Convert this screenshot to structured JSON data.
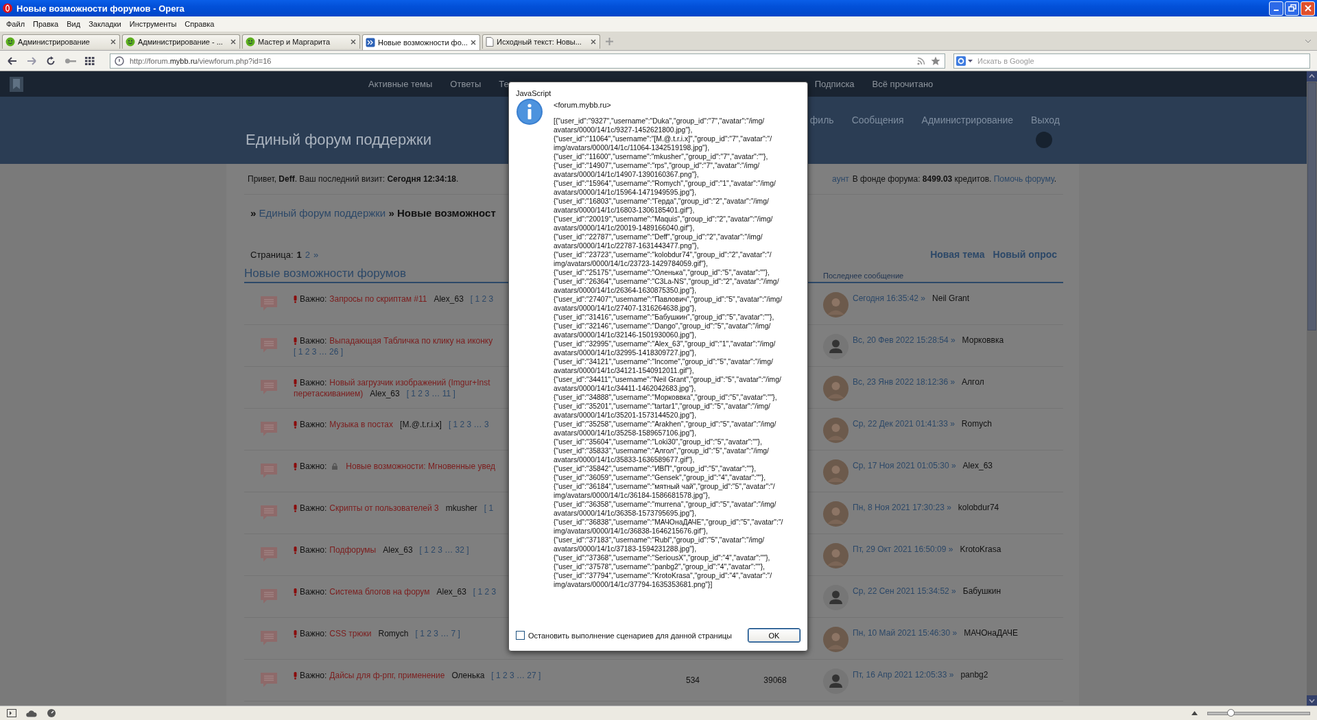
{
  "window": {
    "title": "Новые возможности форумов - Opera"
  },
  "menu": [
    "Файл",
    "Правка",
    "Вид",
    "Закладки",
    "Инструменты",
    "Справка"
  ],
  "tabs": [
    {
      "label": "Администрирование",
      "kind": "green",
      "selected": false
    },
    {
      "label": "Администрирование - ...",
      "kind": "green",
      "selected": false
    },
    {
      "label": "Мастер и Маргарита",
      "kind": "green",
      "selected": false
    },
    {
      "label": "Новые возможности фо...",
      "kind": "forum",
      "selected": true
    },
    {
      "label": "Исходный текст: Новы...",
      "kind": "page",
      "selected": false
    }
  ],
  "address": {
    "value": "http://forum.**mybb.ru**/viewforum.php?id=16"
  },
  "search": {
    "placeholder": "Искать в Google"
  },
  "forum": {
    "nav_left": [
      "Активные темы",
      "Ответы",
      "Те"
    ],
    "nav_right": [
      "Подписка",
      "Всё прочитано"
    ],
    "title": "Единый форум поддержки",
    "header_nav": [
      "филь",
      "Сообщения",
      "Администрирование",
      "Выход"
    ],
    "greeting": "Привет, **Deff**.  Ваш последний визит: **Сегодня 12:34:18**.",
    "account_link": "аунт",
    "fund_text": "В фонде форума: **8499.03** кредитов.",
    "fund_link": "Помочь форуму",
    "fund_end": ".",
    "breadcrumb": {
      "prefix": "»",
      "link": "Единый форум поддержки",
      "current": "» Новые возможност"
    },
    "pagination": {
      "label": "Страница:",
      "current": "1",
      "links": [
        "2",
        "»"
      ]
    },
    "actions": [
      "Новая тема",
      "Новый опрос"
    ],
    "section_title": "Новые возможности форумов",
    "last_post_header": "Последнее сообщение",
    "topics": [
      {
        "lines": [
          [
            {
              "kind": "important",
              "text": "Важно:"
            },
            {
              "kind": "title",
              "text": "Запросы по скриптам #11"
            },
            {
              "kind": "author",
              "text": "Alex_63"
            },
            {
              "kind": "pages",
              "text": "[ 1 2 3"
            }
          ]
        ],
        "last_post": {
          "date": "Сегодня 16:35:42 »",
          "user": "Neil Grant",
          "kind": "photo"
        }
      },
      {
        "lines": [
          [
            {
              "kind": "important",
              "text": "Важно:"
            },
            {
              "kind": "title",
              "text": "Выпадающая Табличка по клику на иконку"
            }
          ],
          [
            {
              "kind": "pages",
              "text": "[ 1 2 3 … 26 ]"
            }
          ]
        ],
        "last_post": {
          "date": "Вс, 20 Фев 2022 15:28:54 »",
          "user": "Морковвка",
          "kind": "default"
        }
      },
      {
        "lines": [
          [
            {
              "kind": "important",
              "text": "Важно:"
            },
            {
              "kind": "title",
              "text": "Новый загрузчик изображений (Imgur+Inst"
            }
          ],
          [
            {
              "kind": "title",
              "text": "перетаскиванием)"
            },
            {
              "kind": "author",
              "text": "Alex_63"
            },
            {
              "kind": "pages",
              "text": "[ 1 2 3 … 11 ]"
            }
          ]
        ],
        "last_post": {
          "date": "Вс, 23 Янв 2022 18:12:36 »",
          "user": "Алгол",
          "kind": "photo"
        }
      },
      {
        "lines": [
          [
            {
              "kind": "important",
              "text": "Важно:"
            },
            {
              "kind": "title",
              "text": "Музыка в постах"
            },
            {
              "kind": "author",
              "text": "[M.@.t.r.i.x]"
            },
            {
              "kind": "pages",
              "text": "[ 1 2 3 … 3"
            }
          ]
        ],
        "last_post": {
          "date": "Ср, 22 Дек 2021 01:41:33 »",
          "user": "Romych",
          "kind": "photo"
        }
      },
      {
        "lines": [
          [
            {
              "kind": "important",
              "text": "Важно:"
            },
            {
              "kind": "lock"
            },
            {
              "kind": "title",
              "text": "Новые возможности: Мгновенные увед"
            }
          ]
        ],
        "last_post": {
          "date": "Ср, 17 Ноя 2021 01:05:30 »",
          "user": "Alex_63",
          "kind": "photo"
        }
      },
      {
        "lines": [
          [
            {
              "kind": "important",
              "text": "Важно:"
            },
            {
              "kind": "title",
              "text": "Скрипты от пользователей 3"
            },
            {
              "kind": "author",
              "text": "mkusher"
            },
            {
              "kind": "pages",
              "text": "[ 1"
            }
          ]
        ],
        "last_post": {
          "date": "Пн, 8 Ноя 2021 17:30:23 »",
          "user": "kolobdur74",
          "kind": "photo"
        }
      },
      {
        "lines": [
          [
            {
              "kind": "important",
              "text": "Важно:"
            },
            {
              "kind": "title",
              "text": "Подфорумы"
            },
            {
              "kind": "author",
              "text": "Alex_63"
            },
            {
              "kind": "pages",
              "text": "[ 1 2 3 … 32 ]"
            }
          ]
        ],
        "last_post": {
          "date": "Пт, 29 Окт 2021 16:50:09 »",
          "user": "KrotoKrasa",
          "kind": "photo"
        }
      },
      {
        "lines": [
          [
            {
              "kind": "important",
              "text": "Важно:"
            },
            {
              "kind": "title",
              "text": "Система блогов на форум"
            },
            {
              "kind": "author",
              "text": "Alex_63"
            },
            {
              "kind": "pages",
              "text": "[ 1 2 3"
            }
          ]
        ],
        "last_post": {
          "date": "Ср, 22 Сен 2021 15:34:52 »",
          "user": "Бабушкин",
          "kind": "default"
        }
      },
      {
        "lines": [
          [
            {
              "kind": "important",
              "text": "Важно:"
            },
            {
              "kind": "title",
              "text": "CSS трюки"
            },
            {
              "kind": "author",
              "text": "Romych"
            },
            {
              "kind": "pages",
              "text": "[ 1 2 3 … 7 ]"
            }
          ]
        ],
        "last_post": {
          "date": "Пн, 10 Май 2021 15:46:30 »",
          "user": "МАЧОнаДАЧЕ",
          "kind": "photo"
        }
      },
      {
        "lines": [
          [
            {
              "kind": "important",
              "text": "Важно:"
            },
            {
              "kind": "title",
              "text": "Дайсы для ф-рпг, применение"
            },
            {
              "kind": "author",
              "text": "Оленька"
            },
            {
              "kind": "pages",
              "text": "[ 1 2 3 … 27 ]"
            }
          ]
        ],
        "replies": "534",
        "views": "39068",
        "last_post": {
          "date": "Пт, 16 Апр 2021 12:05:33 »",
          "user": "panbg2",
          "kind": "default"
        }
      }
    ]
  },
  "dialog": {
    "title": "JavaScript",
    "source": "<forum.mybb.ru>",
    "message_lines": [
      "[{\"user_id\":\"9327\",\"username\":\"Duka\",\"group_id\":\"7\",\"avatar\":\"/img/",
      "avatars/0000/14/1c/9327-1452621800.jpg\"},",
      "{\"user_id\":\"11064\",\"username\":\"[M.@.t.r.i.x]\",\"group_id\":\"7\",\"avatar\":\"/",
      "img/avatars/0000/14/1c/11064-1342519198.jpg\"},",
      "{\"user_id\":\"11600\",\"username\":\"mkusher\",\"group_id\":\"7\",\"avatar\":\"\"},",
      "{\"user_id\":\"14907\",\"username\":\"rps\",\"group_id\":\"7\",\"avatar\":\"/img/",
      "avatars/0000/14/1c/14907-1390160367.png\"},",
      "{\"user_id\":\"15964\",\"username\":\"Romych\",\"group_id\":\"1\",\"avatar\":\"/img/",
      "avatars/0000/14/1c/15964-1471949595.jpg\"},",
      "{\"user_id\":\"16803\",\"username\":\"Герда\",\"group_id\":\"2\",\"avatar\":\"/img/",
      "avatars/0000/14/1c/16803-1306185401.gif\"},",
      "{\"user_id\":\"20019\",\"username\":\"Maquis\",\"group_id\":\"2\",\"avatar\":\"/img/",
      "avatars/0000/14/1c/20019-1489166040.gif\"},",
      "{\"user_id\":\"22787\",\"username\":\"Deff\",\"group_id\":\"2\",\"avatar\":\"/img/",
      "avatars/0000/14/1c/22787-1631443477.png\"},",
      "{\"user_id\":\"23723\",\"username\":\"kolobdur74\",\"group_id\":\"2\",\"avatar\":\"/",
      "img/avatars/0000/14/1c/23723-1429784059.gif\"},",
      "{\"user_id\":\"25175\",\"username\":\"Оленька\",\"group_id\":\"5\",\"avatar\":\"\"},",
      "{\"user_id\":\"26364\",\"username\":\"C3La-NS\",\"group_id\":\"2\",\"avatar\":\"/img/",
      "avatars/0000/14/1c/26364-1630875350.jpg\"},",
      "{\"user_id\":\"27407\",\"username\":\"Павлович\",\"group_id\":\"5\",\"avatar\":\"/img/",
      "avatars/0000/14/1c/27407-1316264638.jpg\"},",
      "{\"user_id\":\"31416\",\"username\":\"Бабушкин\",\"group_id\":\"5\",\"avatar\":\"\"},",
      "{\"user_id\":\"32146\",\"username\":\"Dango\",\"group_id\":\"5\",\"avatar\":\"/img/",
      "avatars/0000/14/1c/32146-1501930060.jpg\"},",
      "{\"user_id\":\"32995\",\"username\":\"Alex_63\",\"group_id\":\"1\",\"avatar\":\"/img/",
      "avatars/0000/14/1c/32995-1418309727.jpg\"},",
      "{\"user_id\":\"34121\",\"username\":\"Income\",\"group_id\":\"5\",\"avatar\":\"/img/",
      "avatars/0000/14/1c/34121-1540912011.gif\"},",
      "{\"user_id\":\"34411\",\"username\":\"Neil Grant\",\"group_id\":\"5\",\"avatar\":\"/img/",
      "avatars/0000/14/1c/34411-1462042683.jpg\"},",
      "{\"user_id\":\"34888\",\"username\":\"Морковвка\",\"group_id\":\"5\",\"avatar\":\"\"},",
      "{\"user_id\":\"35201\",\"username\":\"tartar1\",\"group_id\":\"5\",\"avatar\":\"/img/",
      "avatars/0000/14/1c/35201-1573144520.jpg\"},",
      "{\"user_id\":\"35258\",\"username\":\"Arakhen\",\"group_id\":\"5\",\"avatar\":\"/img/",
      "avatars/0000/14/1c/35258-1589657106.jpg\"},",
      "{\"user_id\":\"35604\",\"username\":\"Loki30\",\"group_id\":\"5\",\"avatar\":\"\"},",
      "{\"user_id\":\"35833\",\"username\":\"Алгол\",\"group_id\":\"5\",\"avatar\":\"/img/",
      "avatars/0000/14/1c/35833-1636589677.gif\"},",
      "{\"user_id\":\"35842\",\"username\":\"ИВП\",\"group_id\":\"5\",\"avatar\":\"\"},",
      "{\"user_id\":\"36059\",\"username\":\"Gensek\",\"group_id\":\"4\",\"avatar\":\"\"},",
      "{\"user_id\":\"36184\",\"username\":\"мятный чай\",\"group_id\":\"5\",\"avatar\":\"/",
      "img/avatars/0000/14/1c/36184-1586681578.jpg\"},",
      "{\"user_id\":\"36358\",\"username\":\"murrena\",\"group_id\":\"5\",\"avatar\":\"/img/",
      "avatars/0000/14/1c/36358-1573795695.jpg\"},",
      "{\"user_id\":\"36838\",\"username\":\"МАЧОнаДАЧЕ\",\"group_id\":\"5\",\"avatar\":\"/",
      "img/avatars/0000/14/1c/36838-1646215676.gif\"},",
      "{\"user_id\":\"37183\",\"username\":\"Rubl\",\"group_id\":\"5\",\"avatar\":\"/img/",
      "avatars/0000/14/1c/37183-1594231288.jpg\"},",
      "{\"user_id\":\"37368\",\"username\":\"SeriousX\",\"group_id\":\"4\",\"avatar\":\"\"},",
      "{\"user_id\":\"37578\",\"username\":\"panbg2\",\"group_id\":\"4\",\"avatar\":\"\"},",
      "{\"user_id\":\"37794\",\"username\":\"KrotoKrasa\",\"group_id\":\"4\",\"avatar\":\"/",
      "img/avatars/0000/14/1c/37794-1635353681.png\"}]"
    ],
    "stop_scripts": {
      "label": "Остановить выполнение сценариев для данной страницы",
      "checked": false
    },
    "ok": "OK"
  },
  "zoom_slider": {
    "level": 0.22
  }
}
